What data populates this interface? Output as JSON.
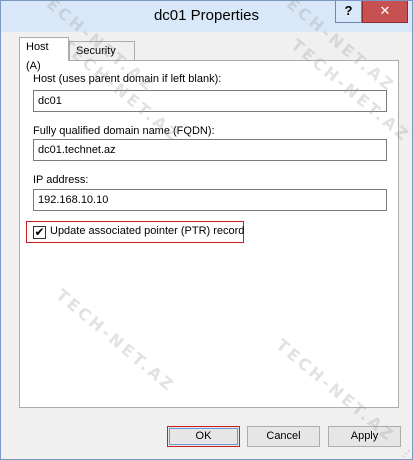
{
  "window": {
    "title": "dc01 Properties",
    "help_glyph": "?",
    "close_glyph": "✕"
  },
  "tabs": [
    {
      "label": "Host (A)",
      "active": true
    },
    {
      "label": "Security",
      "active": false
    }
  ],
  "fields": {
    "host": {
      "label": "Host (uses parent domain if left blank):",
      "value": "dc01"
    },
    "fqdn": {
      "label": "Fully qualified domain name (FQDN):",
      "value": "dc01.technet.az"
    },
    "ip": {
      "label": "IP address:",
      "value": "192.168.10.10"
    }
  },
  "ptr_checkbox": {
    "label": "Update associated pointer (PTR) record",
    "checked": true,
    "glyph": "✔"
  },
  "buttons": {
    "ok": "OK",
    "cancel": "Cancel",
    "apply": "Apply"
  },
  "watermark": "TECH-NET.AZ",
  "colors": {
    "highlight_border": "#cc2020",
    "titlebar": "#d9e8f9",
    "close": "#c75050"
  }
}
